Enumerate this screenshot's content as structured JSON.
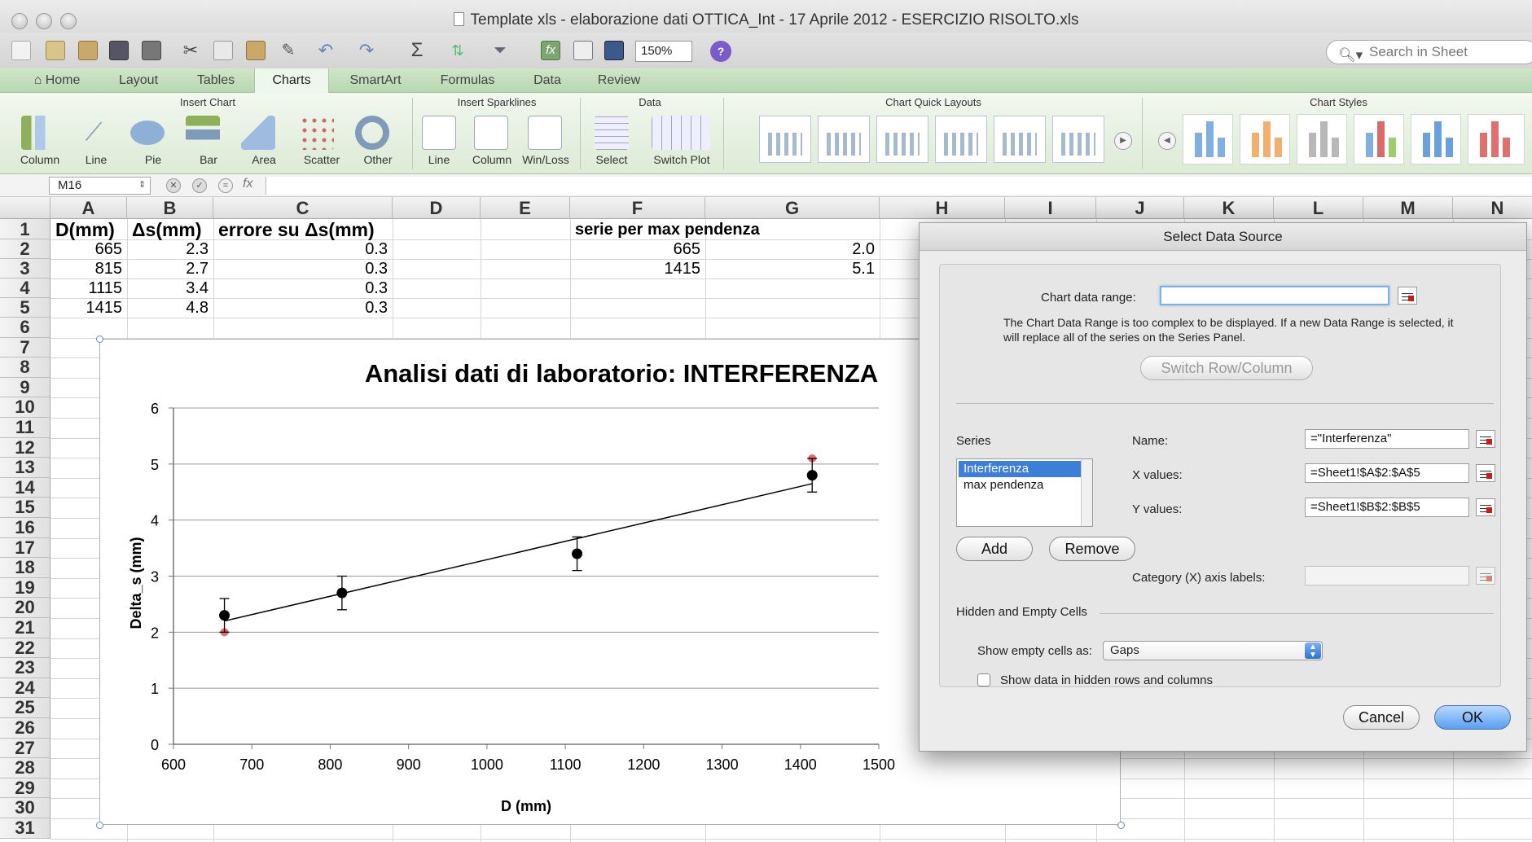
{
  "window": {
    "title": "Template xls - elaborazione dati OTTICA_Int - 17 Aprile 2012 - ESERCIZIO RISOLTO.xls"
  },
  "toolbar": {
    "zoom": "150%",
    "search_placeholder": "Search in Sheet"
  },
  "ribbon": {
    "tabs": [
      "Home",
      "Layout",
      "Tables",
      "Charts",
      "SmartArt",
      "Formulas",
      "Data",
      "Review"
    ],
    "active_tab": "Charts",
    "groups": {
      "insert_chart": {
        "title": "Insert Chart",
        "items": [
          "Column",
          "Line",
          "Pie",
          "Bar",
          "Area",
          "Scatter",
          "Other"
        ]
      },
      "insert_sparklines": {
        "title": "Insert Sparklines",
        "items": [
          "Line",
          "Column",
          "Win/Loss"
        ]
      },
      "data": {
        "title": "Data",
        "items": [
          "Select",
          "Switch Plot"
        ]
      },
      "quick_layouts": {
        "title": "Chart Quick Layouts"
      },
      "styles": {
        "title": "Chart Styles"
      }
    }
  },
  "formula_bar": {
    "cell_ref": "M16",
    "fx": "fx"
  },
  "sheet": {
    "columns": [
      "A",
      "B",
      "C",
      "D",
      "E",
      "F",
      "G",
      "H",
      "I",
      "J",
      "K",
      "L",
      "M",
      "N"
    ],
    "rows": [
      "1",
      "2",
      "3",
      "4",
      "5",
      "6",
      "7",
      "8",
      "9",
      "10",
      "11",
      "12",
      "13",
      "14",
      "15",
      "16",
      "17",
      "18",
      "19",
      "20",
      "21",
      "22",
      "23",
      "24",
      "25",
      "26",
      "27",
      "28",
      "29",
      "30",
      "31"
    ],
    "headers": {
      "a1": "D(mm)",
      "b1": "Δs(mm)",
      "c1": "errore su Δs(mm)",
      "f1": "serie per max pendenza"
    },
    "table": [
      {
        "d": "665",
        "ds": "2.3",
        "err": "0.3"
      },
      {
        "d": "815",
        "ds": "2.7",
        "err": "0.3"
      },
      {
        "d": "1115",
        "ds": "3.4",
        "err": "0.3"
      },
      {
        "d": "1415",
        "ds": "4.8",
        "err": "0.3"
      }
    ],
    "max_slope": [
      {
        "x": "665",
        "y": "2.0"
      },
      {
        "x": "1415",
        "y": "5.1"
      }
    ]
  },
  "chart_data": {
    "type": "scatter",
    "title": "Analisi dati di laboratorio: INTERFERENZA",
    "xlabel": "D (mm)",
    "ylabel": "Delta_s (mm)",
    "xlim": [
      600,
      1500
    ],
    "ylim": [
      0,
      6
    ],
    "x_ticks": [
      "600",
      "700",
      "800",
      "900",
      "1000",
      "1100",
      "1200",
      "1300",
      "1400",
      "1500"
    ],
    "y_ticks": [
      "0",
      "1",
      "2",
      "3",
      "4",
      "5",
      "6"
    ],
    "grid": "horizontal",
    "legend": "none",
    "series": [
      {
        "x": [
          665,
          815,
          1115,
          1415
        ],
        "y": [
          2.3,
          2.7,
          3.4,
          4.8
        ],
        "y_error": 0.3,
        "color": "#000000",
        "trendline": {
          "x": [
            665,
            1415
          ],
          "y": [
            2.2,
            4.65
          ]
        }
      },
      {
        "x": [
          665,
          1415
        ],
        "y": [
          2.0,
          5.1
        ],
        "color": "#e36b6b"
      }
    ]
  },
  "dialog": {
    "title": "Select Data Source",
    "chart_range_label": "Chart data range:",
    "chart_range_value": "",
    "warning": "The Chart Data Range is too complex to be displayed. If a new Data Range is selected, it will replace all of the series on the Series Panel.",
    "switch_button": "Switch Row/Column",
    "series_label": "Series",
    "series": [
      "Interferenza",
      "max pendenza"
    ],
    "selected_series": "Interferenza",
    "name_label": "Name:",
    "name_value": "=\"Interferenza\"",
    "x_label": "X values:",
    "x_value": "=Sheet1!$A$2:$A$5",
    "y_label": "Y values:",
    "y_value": "=Sheet1!$B$2:$B$5",
    "add_button": "Add",
    "remove_button": "Remove",
    "category_label": "Category (X) axis labels:",
    "category_value": "",
    "hidden_section": "Hidden and Empty Cells",
    "empty_cells_label": "Show empty cells as:",
    "empty_cells_value": "Gaps",
    "hidden_rows_label": "Show data in hidden rows and columns",
    "cancel_button": "Cancel",
    "ok_button": "OK"
  },
  "colors": {
    "ribbon_green": "#cfe6c8",
    "selection_blue": "#3d7ed8",
    "ok_blue": "#5a9ff0",
    "series_red": "#e36b6b"
  }
}
